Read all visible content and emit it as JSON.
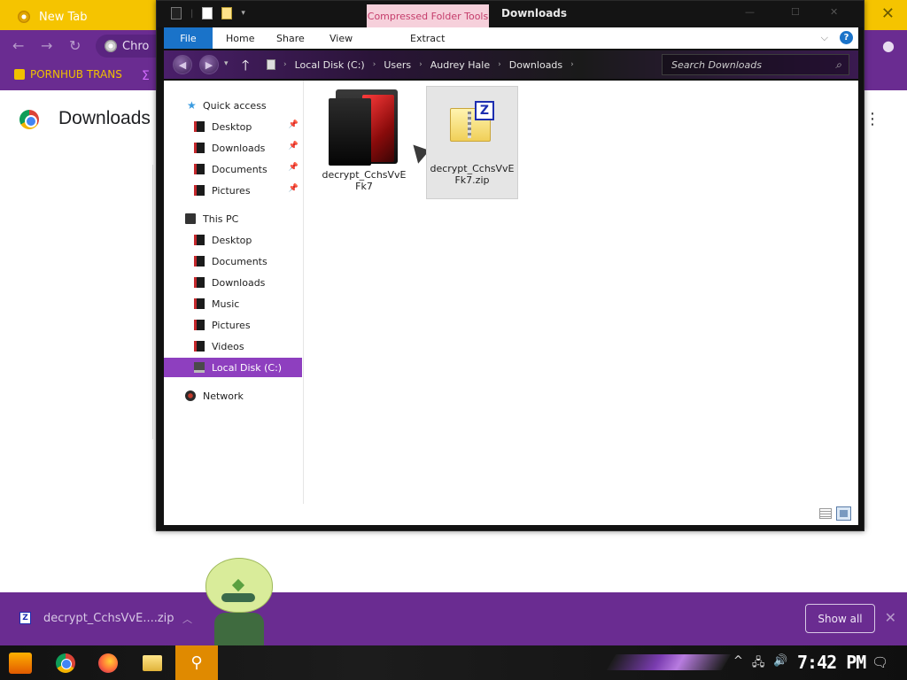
{
  "chrome": {
    "tab_title": "New Tab",
    "omnibox_text": "Chro",
    "bookmark_label": "PORNHUB TRANS",
    "page_title": "Downloads"
  },
  "explorer": {
    "context_tab": "Compressed Folder Tools",
    "window_title": "Downloads",
    "ribbon_tabs": [
      "File",
      "Home",
      "Share",
      "View",
      "Extract"
    ],
    "help": "?",
    "breadcrumbs": [
      "Local Disk (C:)",
      "Users",
      "Audrey Hale",
      "Downloads"
    ],
    "search_placeholder": "Search Downloads",
    "nav": {
      "quick_access": "Quick access",
      "quick_items": [
        "Desktop",
        "Downloads",
        "Documents",
        "Pictures"
      ],
      "this_pc": "This PC",
      "pc_items": [
        "Desktop",
        "Documents",
        "Downloads",
        "Music",
        "Pictures",
        "Videos",
        "Local Disk (C:)"
      ],
      "network": "Network"
    },
    "files": [
      {
        "name": "decrypt_CchsVvEFk7",
        "type": "folder"
      },
      {
        "name": "decrypt_CchsVvEFk7.zip",
        "type": "zip"
      }
    ]
  },
  "download_shelf": {
    "file_name": "decrypt_CchsVvE....zip",
    "show_all": "Show all"
  },
  "taskbar": {
    "clock": "7:42 PM"
  },
  "colors": {
    "accent_purple": "#6a2c91",
    "selected_nav": "#8e3fbf",
    "chrome_tab": "#f5c400",
    "file_tab": "#1a73c9"
  }
}
